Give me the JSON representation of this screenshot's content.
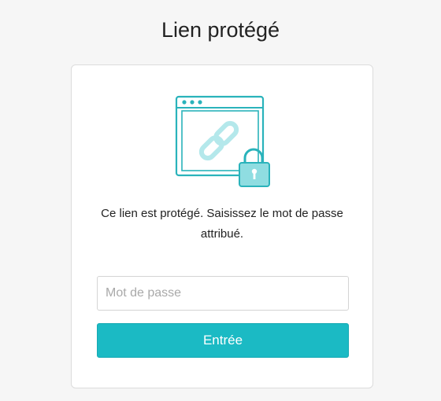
{
  "page": {
    "title": "Lien protégé"
  },
  "card": {
    "message": "Ce lien est protégé. Saisissez le mot de passe attribué."
  },
  "form": {
    "password_placeholder": "Mot de passe",
    "password_value": "",
    "submit_label": "Entrée"
  },
  "illustration": {
    "window_icon": "browser-window-icon",
    "link_icon": "chain-link-icon",
    "lock_icon": "padlock-icon"
  },
  "colors": {
    "accent": "#1bbac4",
    "accent_border": "#16a9b3",
    "illustration_stroke": "#2ab3bb",
    "illustration_fill": "#8fdde1",
    "background": "#f6f6f6",
    "card_border": "#dcdcdc"
  }
}
